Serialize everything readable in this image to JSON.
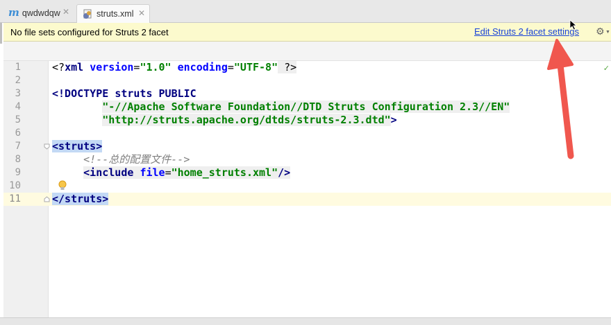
{
  "tabs": [
    {
      "label": "qwdwdqw",
      "icon": "m-icon",
      "active": false
    },
    {
      "label": "struts.xml",
      "icon": "xml-file-icon",
      "active": true
    }
  ],
  "banner": {
    "message": "No file sets configured for Struts 2 facet",
    "link": "Edit Struts 2 facet settings",
    "background": "#fcfacd"
  },
  "editor": {
    "current_line": "11",
    "lines": [
      {
        "number": "1",
        "xml_decl_open": "<?",
        "xml_decl_name": "xml",
        "attr1": "version",
        "eq1": "=",
        "val1": "\"1.0\"",
        "attr2": "encoding",
        "eq2": "=",
        "val2": "\"UTF-8\"",
        "xml_decl_close": " ?>"
      },
      {
        "number": "2"
      },
      {
        "number": "3",
        "doctype": "<!DOCTYPE",
        "root": "struts",
        "public": "PUBLIC"
      },
      {
        "number": "4",
        "public_id": "\"-//Apache Software Foundation//DTD Struts Configuration 2.3//EN\""
      },
      {
        "number": "5",
        "system_id": "\"http://struts.apache.org/dtds/struts-2.3.dtd\"",
        "close": ">"
      },
      {
        "number": "6"
      },
      {
        "number": "7",
        "open_tag": "<struts>"
      },
      {
        "number": "8",
        "comment": "<!--总的配置文件-->"
      },
      {
        "number": "9",
        "tag_open": "<include",
        "attr": "file",
        "eq": "=",
        "value": "\"home_struts.xml\"",
        "tag_close": "/>"
      },
      {
        "number": "10"
      },
      {
        "number": "11",
        "close_tag": "</struts>"
      }
    ]
  },
  "colors": {
    "annotation_arrow": "#f0574e",
    "link": "#1a44d8",
    "tag": "#000080",
    "string": "#008000"
  }
}
